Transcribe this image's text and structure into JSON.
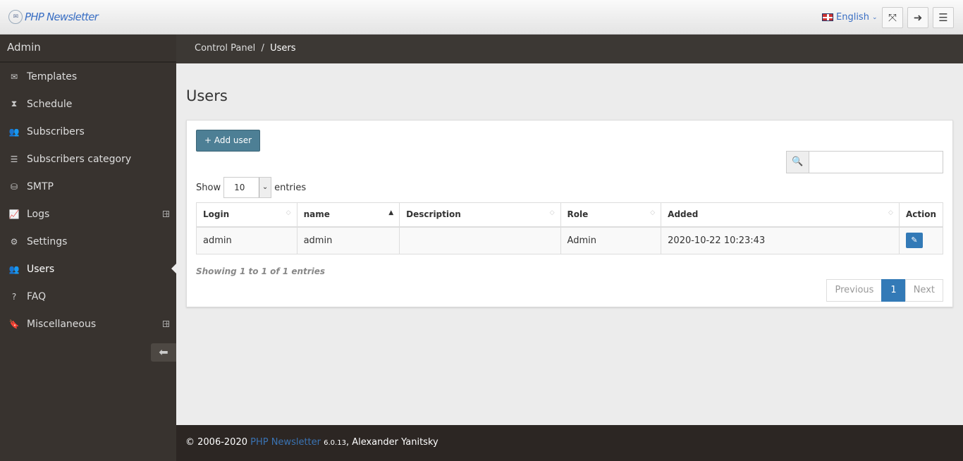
{
  "header": {
    "logo": "PHP Newsletter",
    "language": "English"
  },
  "sidebar": {
    "title": "Admin",
    "items": [
      {
        "label": "Templates",
        "icon": "✉"
      },
      {
        "label": "Schedule",
        "icon": "⧗"
      },
      {
        "label": "Subscribers",
        "icon": "👥"
      },
      {
        "label": "Subscribers category",
        "icon": "☰"
      },
      {
        "label": "SMTP",
        "icon": "⛁"
      },
      {
        "label": "Logs",
        "icon": "📈"
      },
      {
        "label": "Settings",
        "icon": "⚙"
      },
      {
        "label": "Users",
        "icon": "👥"
      },
      {
        "label": "FAQ",
        "icon": "?"
      },
      {
        "label": "Miscellaneous",
        "icon": "🔖"
      }
    ]
  },
  "breadcrumb": {
    "root": "Control Panel",
    "sep": "/",
    "current": "Users"
  },
  "page": {
    "title": "Users",
    "add_label": "+ Add user",
    "search_value": "",
    "show": "Show",
    "entries": "entries",
    "page_size": "10",
    "columns": [
      "Login",
      "name",
      "Description",
      "Role",
      "Added",
      "Action"
    ],
    "rows": [
      {
        "login": "admin",
        "name": "admin",
        "description": "",
        "role": "Admin",
        "added": "2020-10-22 10:23:43"
      }
    ],
    "info": "Showing 1 to 1 of 1 entries",
    "prev": "Previous",
    "page": "1",
    "next": "Next"
  },
  "footer": {
    "copy": "© 2006-2020 ",
    "link": "PHP Newsletter",
    "version": "6.0.13",
    "author": ", Alexander Yanitsky"
  }
}
